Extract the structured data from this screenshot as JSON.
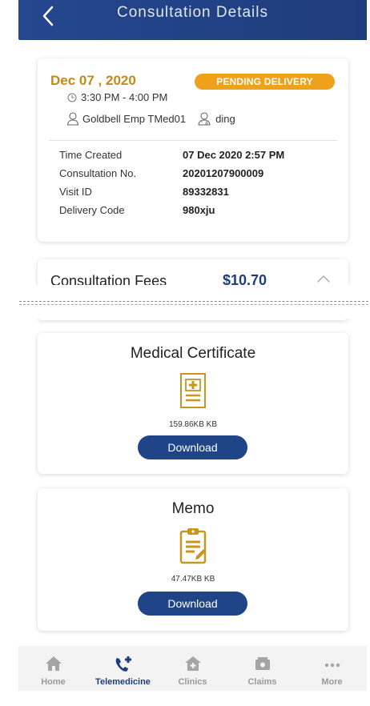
{
  "header": {
    "title": "Consultation Details",
    "back_icon": "chevron-left-icon"
  },
  "consultation": {
    "date": "Dec 07 , 2020",
    "status": "PENDING DELIVERY",
    "time_slot": "3:30 PM - 4:00 PM",
    "patient_name": "Goldbell Emp TMed01",
    "doctor_name": "ding",
    "details": [
      {
        "label": "Time Created",
        "value": "07 Dec 2020 2:57 PM"
      },
      {
        "label": "Consultation No.",
        "value": "20201207900009"
      },
      {
        "label": "Visit ID",
        "value": "89332831"
      },
      {
        "label": "Delivery Code",
        "value": "980xju"
      }
    ]
  },
  "fees": {
    "label": "Consultation Fees",
    "amount": "$10.70"
  },
  "documents": {
    "medical_certificate": {
      "title": "Medical Certificate",
      "size": "159.86KB KB",
      "button": "Download",
      "icon": "medical-certificate-icon"
    },
    "memo": {
      "title": "Memo",
      "size": "47.47KB KB",
      "button": "Download",
      "icon": "memo-clipboard-icon"
    }
  },
  "bottom_nav": {
    "items": [
      {
        "label": "Home",
        "icon": "home-icon"
      },
      {
        "label": "Telemedicine",
        "icon": "telemedicine-icon"
      },
      {
        "label": "Clinics",
        "icon": "clinic-icon"
      },
      {
        "label": "Claims",
        "icon": "claims-icon"
      },
      {
        "label": "More",
        "icon": "more-icon"
      }
    ],
    "active_index": 1
  },
  "colors": {
    "header": "#1f3d7d",
    "accent_gold": "#c28a16",
    "status_orange": "#f0a11c",
    "button_blue": "#1f4487"
  }
}
